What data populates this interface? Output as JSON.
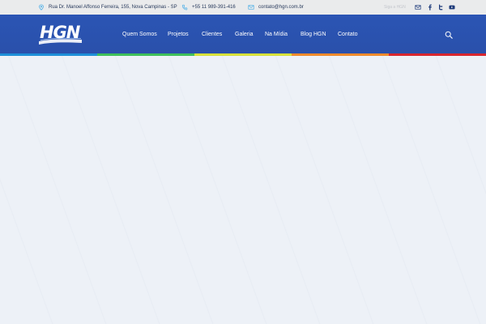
{
  "topbar": {
    "address": "Rua Dr. Manoel Affonso Ferreira, 155, Nova Campinas - SP",
    "phone": "+55 11 989-391-416",
    "email": "contato@hgn.com.br",
    "follow_label": "Siga a HGN",
    "social_icons": [
      "mail-icon",
      "facebook-icon",
      "twitter-icon",
      "youtube-icon"
    ]
  },
  "header": {
    "logo_text": "HGN",
    "nav": [
      {
        "label": "Quem Somos"
      },
      {
        "label": "Projetos"
      },
      {
        "label": "Clientes"
      },
      {
        "label": "Galeria"
      },
      {
        "label": "Na Mídia"
      },
      {
        "label": "Blog HGN"
      },
      {
        "label": "Contato"
      }
    ],
    "search_icon": "search-icon"
  },
  "colors": {
    "brand_blue": "#2b55b4",
    "topbar_bg": "#eaebec",
    "content_bg": "#edf1f7",
    "stripe": [
      "#1e8fd8",
      "#3fbf5a",
      "#d7e13a",
      "#f08a2c",
      "#d8262f"
    ]
  }
}
